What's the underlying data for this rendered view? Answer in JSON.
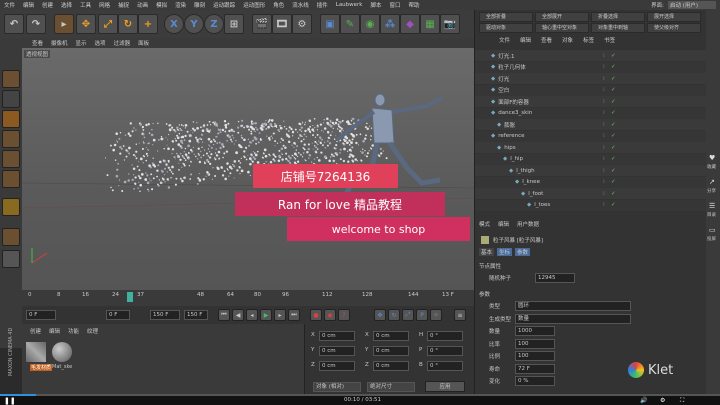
{
  "menubar": {
    "items": [
      "文件",
      "编辑",
      "创建",
      "选择",
      "工具",
      "网格",
      "捕捉",
      "动画",
      "模拟",
      "渲染",
      "雕刻",
      "运动跟踪",
      "运动图形",
      "角色",
      "流水线",
      "插件",
      "Laubwerk",
      "脚本",
      "窗口",
      "帮助"
    ],
    "layout_label": "界面:",
    "layout_value": "启动 (用户)"
  },
  "toolbar": {
    "axis_x": "X",
    "axis_y": "Y",
    "axis_z": "Z"
  },
  "viewport": {
    "menu": [
      "查看",
      "摄像机",
      "显示",
      "选项",
      "过滤器",
      "面板"
    ],
    "title": "透视视图"
  },
  "banners": {
    "shop": "店铺号7264136",
    "tutorial": "Ran for love 精品教程",
    "welcome": "welcome to shop"
  },
  "timeline": {
    "ticks": [
      "0",
      "8",
      "16",
      "24",
      "37",
      "48",
      "64",
      "80",
      "96",
      "112",
      "128",
      "144",
      "13 F"
    ],
    "current_frame": "0 F",
    "start_frame": "0 F",
    "end_frame": "150 F",
    "end_frame2": "150 F"
  },
  "material_panel": {
    "menu": [
      "创建",
      "编辑",
      "功能",
      "纹理"
    ],
    "materials": [
      {
        "label": "毛发材质"
      },
      {
        "label": "Mat_ske"
      }
    ],
    "brand": "MAXON CINEMA 4D"
  },
  "coord_panel": {
    "rows": [
      {
        "axis": "X",
        "value": "0 cm",
        "axis2": "X",
        "value2": "0 cm",
        "axis3": "H",
        "value3": "0 °"
      },
      {
        "axis": "Y",
        "value": "0 cm",
        "axis2": "Y",
        "value2": "0 cm",
        "axis3": "P",
        "value3": "0 °"
      },
      {
        "axis": "Z",
        "value": "0 cm",
        "axis2": "Z",
        "value2": "0 cm",
        "axis3": "B",
        "value3": "0 °"
      }
    ],
    "mode_select": "对象 (相对)",
    "size_select": "绝对尺寸",
    "apply": "应用"
  },
  "right_panel": {
    "top_buttons": [
      "全部折叠",
      "全部展开",
      "折叠选择",
      "展开选择",
      "驱动对象",
      "轴心重中空对象",
      "对象重中到轴",
      "使父级对齐"
    ],
    "om_tabs": [
      "文件",
      "编辑",
      "查看",
      "对象",
      "标签",
      "书签"
    ],
    "objects": [
      {
        "name": "灯光.1",
        "indent": 0
      },
      {
        "name": "粒子几何体",
        "indent": 0
      },
      {
        "name": "灯光",
        "indent": 0
      },
      {
        "name": "空白",
        "indent": 0
      },
      {
        "name": "面部F的容器",
        "indent": 0
      },
      {
        "name": "dance3_skin",
        "indent": 0
      },
      {
        "name": "膨胀",
        "indent": 1
      },
      {
        "name": "reference",
        "indent": 0
      },
      {
        "name": "hips",
        "indent": 1
      },
      {
        "name": "l_hip",
        "indent": 2
      },
      {
        "name": "l_thigh",
        "indent": 3
      },
      {
        "name": "l_knee",
        "indent": 4
      },
      {
        "name": "l_foot",
        "indent": 5
      },
      {
        "name": "l_toes",
        "indent": 6
      }
    ],
    "am_tabs": [
      "模式",
      "编辑",
      "用户数据"
    ],
    "am_title": "粒子风暴 [粒子风暴]",
    "am_subtabs": [
      "基本",
      "坐标",
      "参数"
    ],
    "section1": "节点属性",
    "rows1": [
      {
        "label": "随机种子",
        "value": "12945"
      }
    ],
    "section2": "参数",
    "rows2": [
      {
        "label": "类型",
        "value": "圆环"
      },
      {
        "label": "生成类型",
        "value": "数量"
      },
      {
        "label": "数量",
        "value": "1000"
      },
      {
        "label": "比率",
        "value": "100"
      },
      {
        "label": "比例",
        "value": "100"
      },
      {
        "label": "寿命",
        "value": "72 F"
      },
      {
        "label": "变化",
        "value": "0 %"
      }
    ]
  },
  "sidebar": {
    "labels": [
      "收藏",
      "分享",
      "目录",
      "投屏"
    ]
  },
  "player": {
    "time": "00:10 / 03:51",
    "logo": "Klet",
    "progress": 0.05
  }
}
